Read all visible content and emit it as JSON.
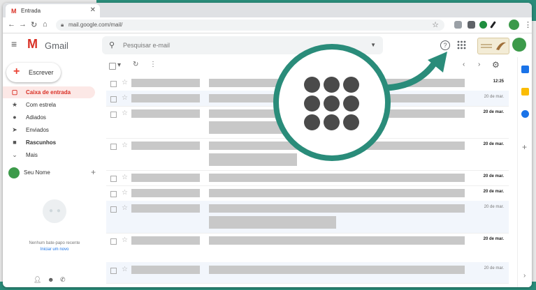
{
  "browser": {
    "tab_title": "Entrada",
    "tab_favicon": "M",
    "url": "mail.google.com/mail/",
    "close_glyph": "✕"
  },
  "gmail": {
    "logo_letter": "M",
    "logo_text": "Gmail",
    "search_placeholder": "Pesquisar e-mail",
    "help_glyph": "?"
  },
  "sidebar": {
    "compose_label": "Escrever",
    "items": [
      {
        "label": "Caixa de entrada",
        "icon": "inbox-icon",
        "glyph": "▢"
      },
      {
        "label": "Com estrela",
        "icon": "star-icon",
        "glyph": "★"
      },
      {
        "label": "Adiados",
        "icon": "clock-icon",
        "glyph": "●"
      },
      {
        "label": "Enviados",
        "icon": "send-icon",
        "glyph": "➤"
      },
      {
        "label": "Rascunhos",
        "icon": "draft-icon",
        "glyph": "■"
      },
      {
        "label": "Mais",
        "icon": "chevron-down-icon",
        "glyph": "⌄"
      }
    ],
    "user_name": "Seu Nome",
    "no_chat_text": "Nenhum bate-papo recente",
    "start_chat_link": "Iniciar um novo"
  },
  "list": {
    "dates": [
      "12:25",
      "20 de mar.",
      "20 de mar.",
      "20 de mar.",
      "20 de mar.",
      "20 de mar.",
      "20 de mar.",
      "20 de mar.",
      "20 de mar."
    ]
  },
  "colors": {
    "accent_teal": "#2a8c7a",
    "gmail_red": "#d93025",
    "placeholder_gray": "#c8c8c8"
  }
}
